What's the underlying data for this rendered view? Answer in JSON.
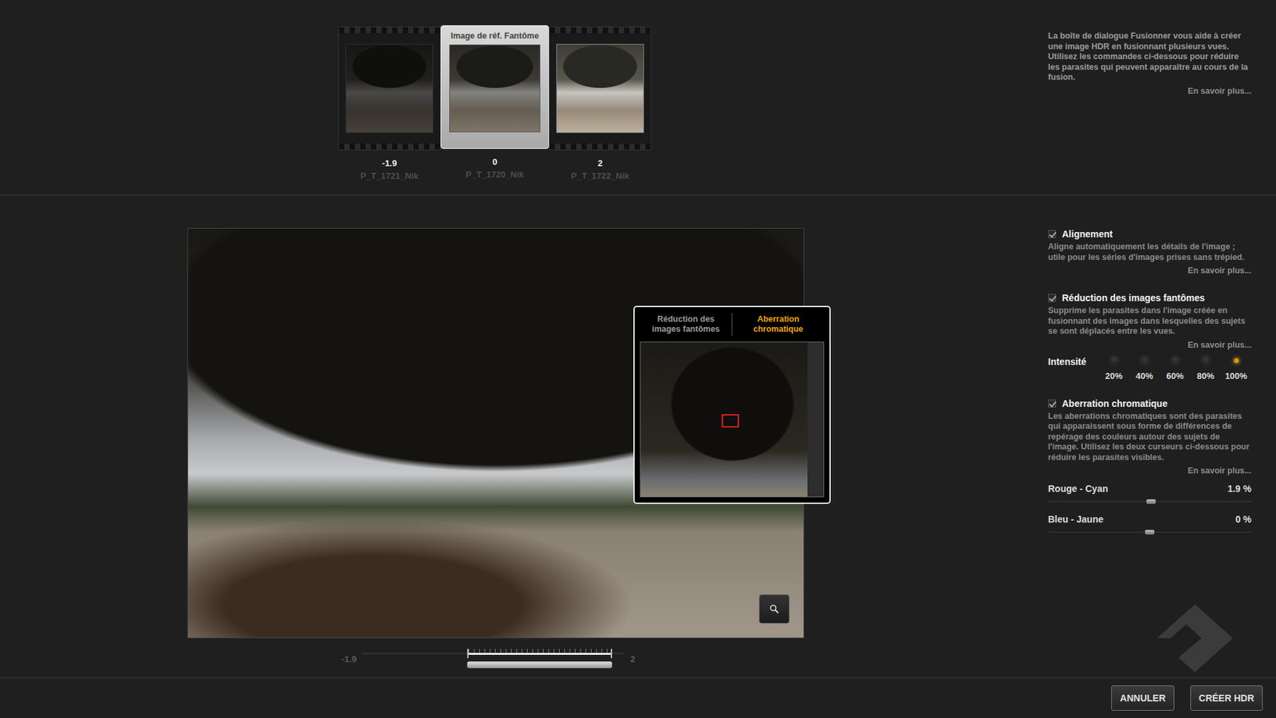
{
  "filmstrip": {
    "reference_label": "Image de réf. Fantôme",
    "frames": [
      {
        "ev": "-1.9",
        "file": "P_T_1721_Nik",
        "selected": false
      },
      {
        "ev": "0",
        "file": "P_T_1720_Nik",
        "selected": true
      },
      {
        "ev": "2",
        "file": "P_T_1722_Nik",
        "selected": false
      }
    ]
  },
  "intro": {
    "text": "La boîte de dialogue Fusionner vous aide à créer une image HDR en fusionnant plusieurs vues. Utilisez les commandes ci-dessous pour réduire les parasites qui peuvent apparaître au cours de la fusion.",
    "link": "En savoir plus..."
  },
  "loupe": {
    "tabs": [
      {
        "label": "Réduction des images fantômes",
        "selected": false
      },
      {
        "label": "Aberration chromatique",
        "selected": true
      }
    ]
  },
  "exposure_slider": {
    "min": "-1.9",
    "max": "2",
    "range_start": 0.4,
    "range_end": 0.95
  },
  "sections": [
    {
      "title": "Alignement",
      "checked": true,
      "description": "Aligne automatiquement les détails de l'image ; utile pour les séries d'images prises sans trépied.",
      "link": "En savoir plus..."
    },
    {
      "title": "Réduction des images fantômes",
      "checked": true,
      "description": "Supprime les parasites dans l'image créée en fusionnant des images dans lesquelles des sujets se sont déplacés entre les vues.",
      "link": "En savoir plus...",
      "intensity": {
        "label": "Intensité",
        "options": [
          {
            "label": "20%",
            "selected": false
          },
          {
            "label": "40%",
            "selected": false
          },
          {
            "label": "60%",
            "selected": false
          },
          {
            "label": "80%",
            "selected": false
          },
          {
            "label": "100%",
            "selected": true
          }
        ]
      }
    },
    {
      "title": "Aberration chromatique",
      "checked": true,
      "description": "Les aberrations chromatiques sont des parasites qui apparaissent sous forme de différences de repérage des couleurs autour des sujets de l'image. Utilisez les deux curseurs ci-dessous pour réduire les parasites visibles.",
      "link": "En savoir plus...",
      "sliders": [
        {
          "label": "Rouge - Cyan",
          "reading": "1.9 %",
          "level": 0.505
        },
        {
          "label": "Bleu - Jaune",
          "reading": "0 %",
          "level": 0.5
        }
      ]
    }
  ],
  "buttons": [
    {
      "label": "ANNULER"
    },
    {
      "label": "CRÉER HDR"
    }
  ]
}
